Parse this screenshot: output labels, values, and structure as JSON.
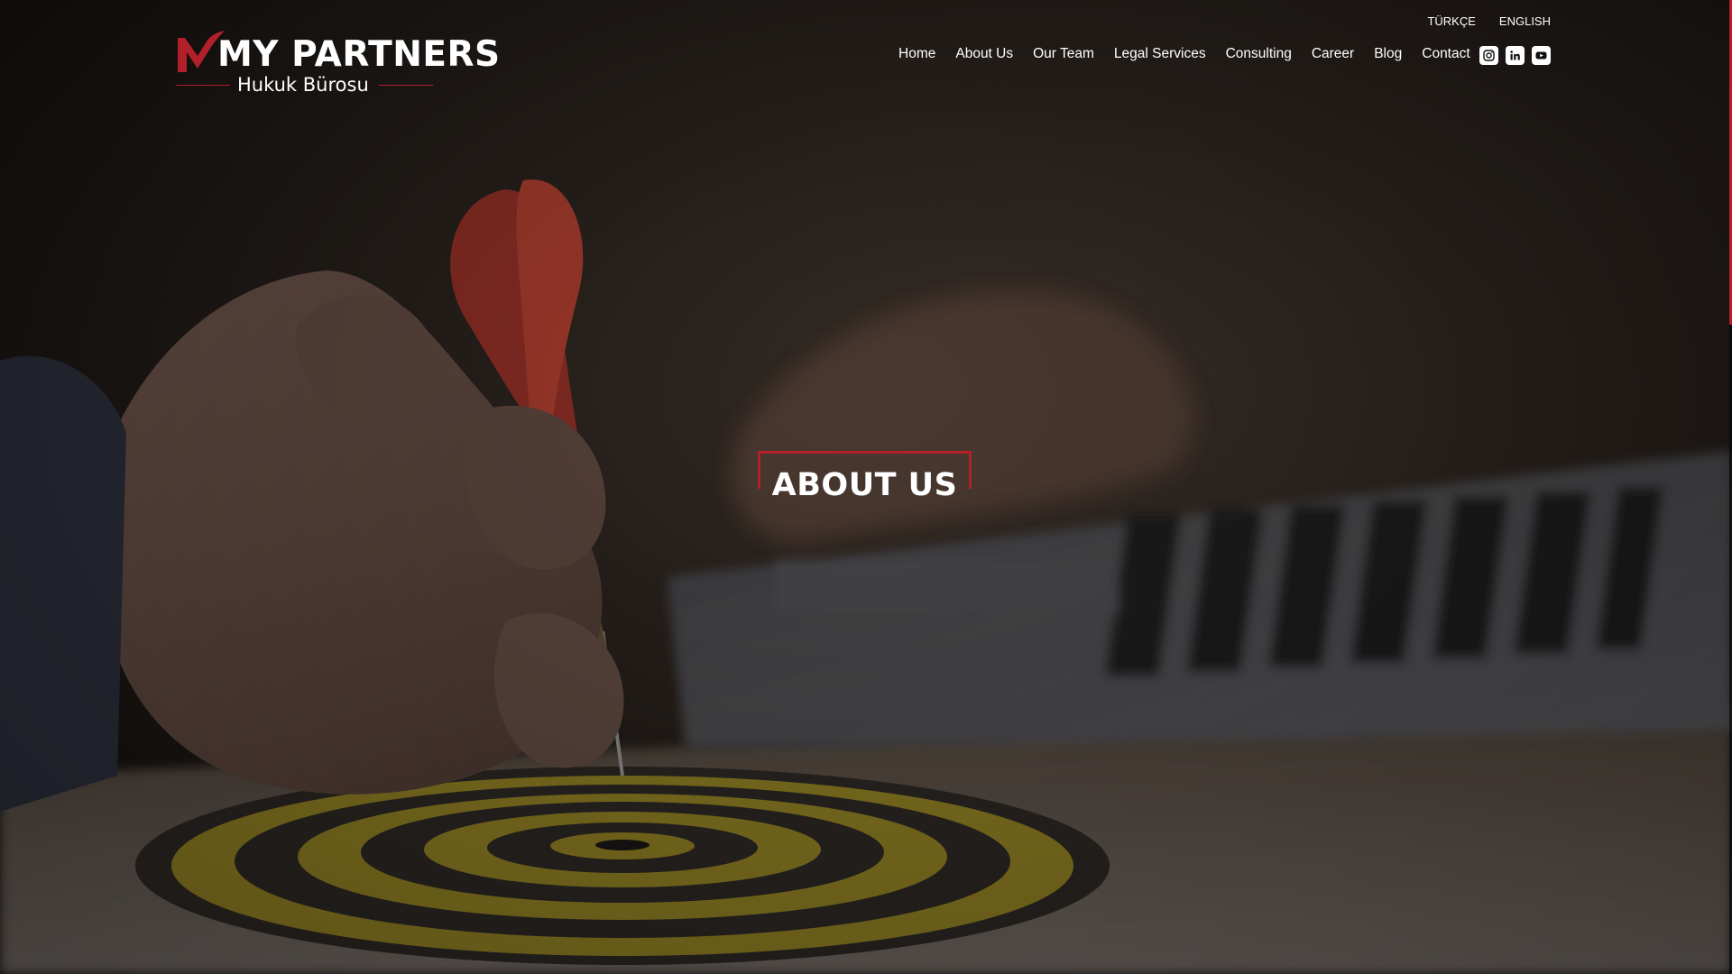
{
  "brand": {
    "name": "MY PARTNERS",
    "subtitle": "Hukuk Bürosu",
    "accent_color": "#b1202b"
  },
  "languages": [
    "TÜRKÇE",
    "ENGLISH"
  ],
  "nav": {
    "items": [
      "Home",
      "About Us",
      "Our Team",
      "Legal Services",
      "Consulting",
      "Career",
      "Blog",
      "Contact"
    ]
  },
  "social": [
    {
      "icon": "instagram-icon"
    },
    {
      "icon": "linkedin-icon"
    },
    {
      "icon": "youtube-icon"
    }
  ],
  "hero": {
    "title": "ABOUT US",
    "background_image": "hand throwing dart at dartboard, laptop in background, dark overlay"
  }
}
